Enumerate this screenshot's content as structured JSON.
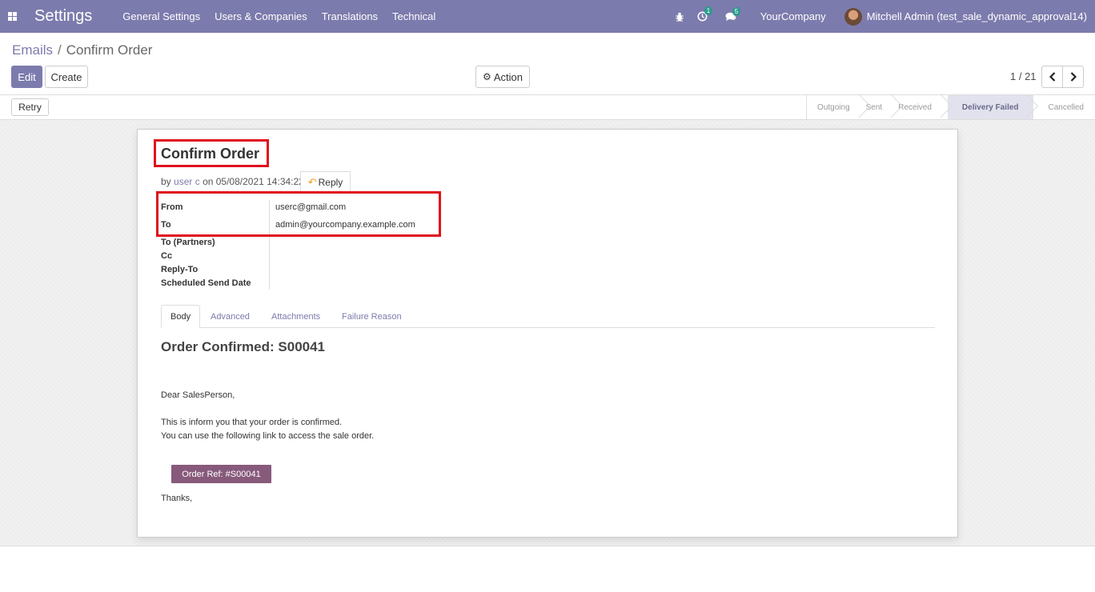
{
  "navbar": {
    "brand": "Settings",
    "menu": [
      "General Settings",
      "Users & Companies",
      "Translations",
      "Technical"
    ],
    "activity_count": "1",
    "message_count": "5",
    "company": "YourCompany",
    "user": "Mitchell Admin (test_sale_dynamic_approval14)"
  },
  "breadcrumb": {
    "parent": "Emails",
    "separator": "/",
    "current": "Confirm Order"
  },
  "buttons": {
    "edit": "Edit",
    "create": "Create",
    "action": "Action",
    "retry": "Retry"
  },
  "pager": {
    "text": "1 / 21"
  },
  "status": {
    "steps": [
      "Outgoing",
      "Sent",
      "Received",
      "Delivery Failed",
      "Cancelled"
    ],
    "active": "Delivery Failed"
  },
  "record": {
    "title": "Confirm Order",
    "by_prefix": "by",
    "author": "user c",
    "date_text": "on 05/08/2021 14:34:22",
    "reply_label": "Reply",
    "fields": {
      "from_label": "From",
      "from_value": "userc@gmail.com",
      "to_label": "To",
      "to_value": "admin@yourcompany.example.com",
      "to_partners_label": "To (Partners)",
      "cc_label": "Cc",
      "reply_to_label": "Reply-To",
      "scheduled_label": "Scheduled Send Date"
    }
  },
  "tabs": [
    "Body",
    "Advanced",
    "Attachments",
    "Failure Reason"
  ],
  "body": {
    "heading": "Order Confirmed: S00041",
    "greeting": "Dear SalesPerson,",
    "line1": "This is inform you that your order is confirmed.",
    "line2": "You can use the following link to access the sale order.",
    "order_button": "Order Ref: #S00041",
    "closing": "Thanks,"
  },
  "colors": {
    "navbar": "#7c7bad",
    "primary": "#7c7bad",
    "highlight": "#e0111d",
    "order_button": "#875a7b"
  }
}
